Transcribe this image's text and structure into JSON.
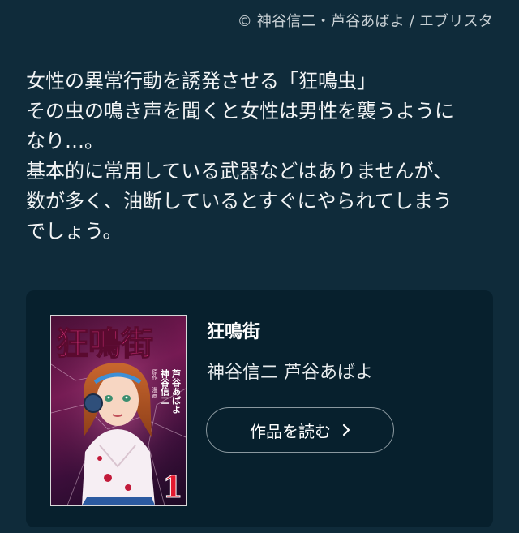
{
  "credit": "© 神谷信二・芦谷あばよ / エブリスタ",
  "description": {
    "lines": [
      "女性の異常行動を誘発させる「狂鳴虫」",
      "その虫の鳴き声を聞くと女性は男性を襲うように",
      "なり…。",
      "基本的に常用している武器などはありませんが、",
      "数が多く、油断しているとすぐにやられてしまう",
      "でしょう。"
    ]
  },
  "book": {
    "title": "狂鳴街",
    "authors": "神谷信二 芦谷あばよ",
    "read_button": "作品を読む",
    "cover": {
      "title_text": "狂鳴街",
      "credit_role_1": "原作",
      "credit_role_2": "漫画",
      "credit_name_1": "神谷信二",
      "credit_name_2": "芦谷あばよ",
      "volume": "1"
    }
  }
}
